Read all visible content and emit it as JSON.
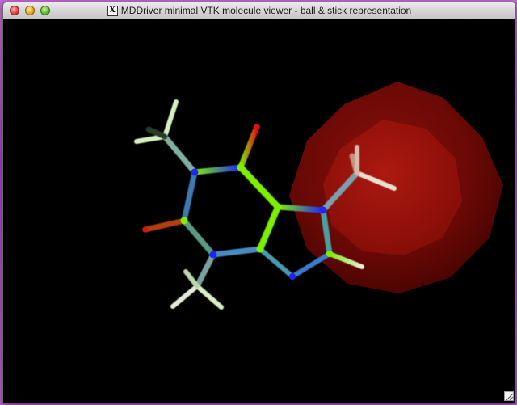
{
  "window": {
    "title": "MDDriver minimal VTK molecule viewer - ball & stick representation",
    "app_icon": "x11-icon",
    "app_icon_glyph": "X"
  },
  "titlebar_buttons": [
    {
      "name": "close-button",
      "color": "#e2463b"
    },
    {
      "name": "minimize-button",
      "color": "#e9a826"
    },
    {
      "name": "zoom-button",
      "color": "#5cbf2c"
    }
  ],
  "render_view": {
    "background": "#000000",
    "representation": "ball & stick",
    "colors": {
      "carbon": "#7cf000",
      "nitrogen": "#1e24ff",
      "oxygen": "#e01010",
      "hydrogen": "#e8e8d8",
      "highlight_sphere": "#8a0a08"
    }
  }
}
